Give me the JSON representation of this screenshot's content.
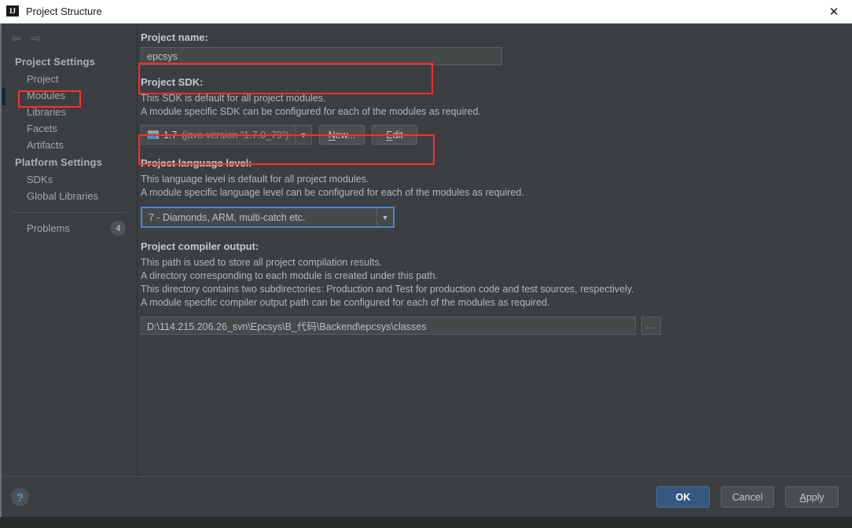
{
  "window": {
    "title": "Project Structure",
    "title_icon": "intellij-idea-icon",
    "close_icon": "✕"
  },
  "sidebar": {
    "nav": {
      "back_icon": "⇦",
      "forward_icon": "⇨"
    },
    "groups": [
      {
        "label": "Project Settings",
        "items": [
          {
            "label": "Project",
            "selected": true
          },
          {
            "label": "Modules",
            "selected": false
          },
          {
            "label": "Libraries",
            "selected": false
          },
          {
            "label": "Facets",
            "selected": false
          },
          {
            "label": "Artifacts",
            "selected": false
          }
        ]
      },
      {
        "label": "Platform Settings",
        "items": [
          {
            "label": "SDKs",
            "selected": false
          },
          {
            "label": "Global Libraries",
            "selected": false
          }
        ]
      }
    ],
    "problems": {
      "label": "Problems",
      "count": "4"
    }
  },
  "main": {
    "project_name": {
      "label": "Project name:",
      "value": "epcsys"
    },
    "project_sdk": {
      "label": "Project SDK:",
      "desc_line_1": "This SDK is default for all project modules.",
      "desc_line_2": "A module specific SDK can be configured for each of the modules as required.",
      "value": "1.7",
      "value_detail": "(java version \"1.7.0_79\")",
      "arrow_icon": "▼",
      "new_button": "New...",
      "edit_button": "Edit"
    },
    "language_level": {
      "label": "Project language level:",
      "desc_line_1": "This language level is default for all project modules.",
      "desc_line_2": "A module specific language level can be configured for each of the modules as required.",
      "value": "7 - Diamonds, ARM, multi-catch etc.",
      "arrow_icon": "▼"
    },
    "compiler_output": {
      "label": "Project compiler output:",
      "desc_line_1": "This path is used to store all project compilation results.",
      "desc_line_2": "A directory corresponding to each module is created under this path.",
      "desc_line_3": "This directory contains two subdirectories: Production and Test for production code and test sources, respectively.",
      "desc_line_4": "A module specific compiler output path can be configured for each of the modules as required.",
      "value": "D:\\114.215.206.26_svn\\Epcsys\\B_代码\\Backend\\epcsys\\classes",
      "browse_button": "..."
    }
  },
  "footer": {
    "help_icon": "?",
    "ok_button": "OK",
    "cancel_button": "Cancel",
    "apply_button": "Apply"
  },
  "annotations": {
    "accent_color": "#ff2d2d",
    "focus_color": "#4a88c7"
  }
}
